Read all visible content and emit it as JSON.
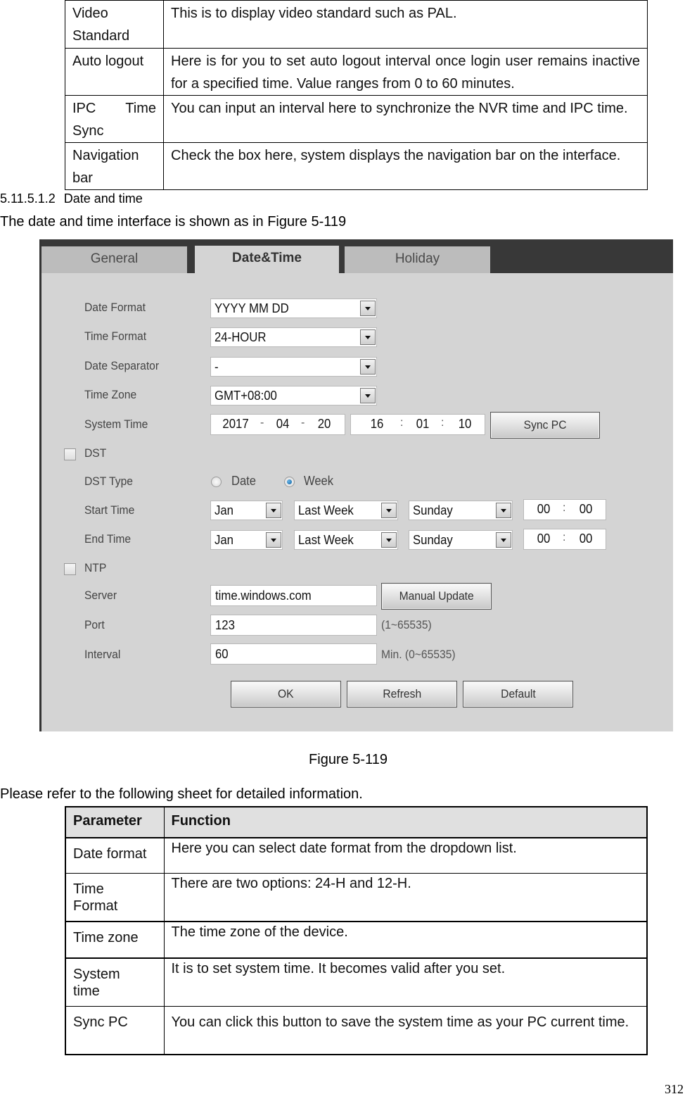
{
  "top_table": {
    "rows": [
      {
        "parameter": "Video Standard",
        "function": "This is to display video standard such as PAL."
      },
      {
        "parameter": "Auto logout",
        "function": "Here is for you to set auto logout interval once login user remains inactive for a specified time. Value ranges from 0 to 60 minutes."
      },
      {
        "parameter": "IPC Time Sync",
        "function": "You can input an interval here to synchronize the NVR time and IPC time."
      },
      {
        "parameter": "Navigation bar",
        "function": "Check the box here, system displays the navigation bar on the interface."
      }
    ]
  },
  "section": {
    "number": "5.11.5.1.2",
    "title": "Date and time",
    "intro": "The date and time interface is shown as in Figure 5-119"
  },
  "figure_ui": {
    "tabs": [
      {
        "label": "General",
        "active": false
      },
      {
        "label": "Date&Time",
        "active": true
      },
      {
        "label": "Holiday",
        "active": false
      }
    ],
    "labels": {
      "date_format": "Date Format",
      "time_format": "Time Format",
      "date_separator": "Date Separator",
      "time_zone": "Time Zone",
      "system_time": "System Time",
      "dst": "DST",
      "dst_type": "DST Type",
      "start_time": "Start Time",
      "end_time": "End Time",
      "ntp": "NTP",
      "server": "Server",
      "port": "Port",
      "interval": "Interval"
    },
    "date_format": "YYYY MM DD",
    "time_format": "24-HOUR",
    "date_separator": "-",
    "time_zone": "GMT+08:00",
    "system_date": {
      "year": "2017",
      "month": "04",
      "day": "20",
      "sep": "-"
    },
    "system_clock": {
      "hour": "16",
      "minute": "01",
      "second": "10",
      "sep": ":"
    },
    "sync_pc_label": "Sync PC",
    "dst_checked": false,
    "dst_type": {
      "options": [
        "Date",
        "Week"
      ],
      "selected": "Week"
    },
    "start_time": {
      "month": "Jan",
      "week": "Last Week",
      "day": "Sunday",
      "hour": "00",
      "minute": "00"
    },
    "end_time": {
      "month": "Jan",
      "week": "Last Week",
      "day": "Sunday",
      "hour": "00",
      "minute": "00"
    },
    "ntp_checked": false,
    "server": "time.windows.com",
    "manual_update_label": "Manual Update",
    "port": "123",
    "port_hint": "(1~65535)",
    "interval": "60",
    "interval_hint": "Min. (0~65535)",
    "buttons": {
      "ok": "OK",
      "refresh": "Refresh",
      "default": "Default"
    }
  },
  "caption": "Figure 5-119",
  "sheet_intro": "Please refer to the following sheet for detailed information.",
  "param_table": {
    "headers": [
      "Parameter",
      "Function"
    ],
    "rows": [
      {
        "parameter": "Date format",
        "function": "Here you can select date format from the dropdown list."
      },
      {
        "parameter": "Time Format",
        "function": "There are two options: 24-H and 12-H."
      },
      {
        "parameter": "Time zone",
        "function": "The time zone of the device."
      },
      {
        "parameter": "System time",
        "function": "It is to set system time. It becomes valid after you set."
      },
      {
        "parameter": "Sync PC",
        "function": "You can click this button to save the system time as your PC current time."
      }
    ]
  },
  "page_number": "312"
}
